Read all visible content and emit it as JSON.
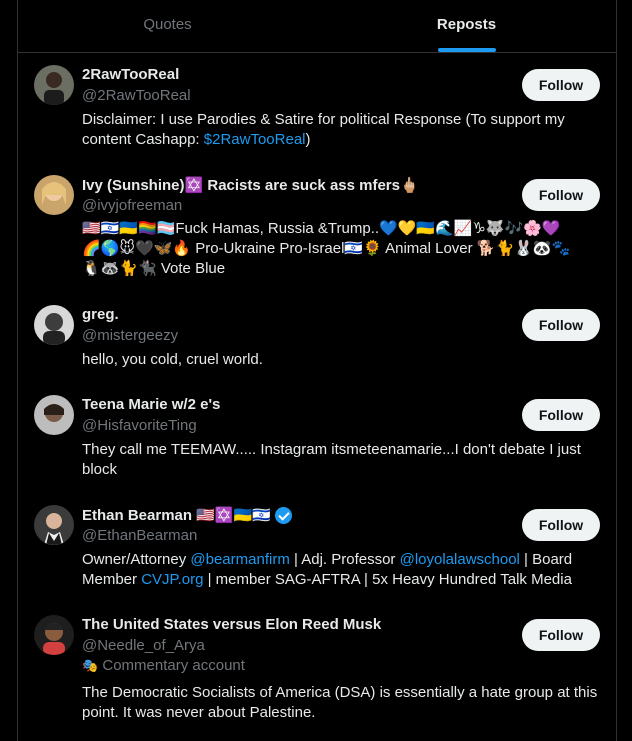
{
  "tabs": [
    {
      "label": "Quotes",
      "active": false
    },
    {
      "label": "Reposts",
      "active": true
    }
  ],
  "follow_label": "Follow",
  "users": [
    {
      "name": "2RawTooReal",
      "handle": "@2RawTooReal",
      "bio_text": "Disclaimer: I use Parodies & Satire for political Response (To support my content Cashapp: ",
      "bio_link": "$2RawTooReal",
      "bio_end": ")"
    },
    {
      "name": "Ivy (Sunshine)✡️ Racists are suck ass mfers🖕🏼",
      "handle": "@ivyjofreeman",
      "bio_line1": "🇺🇸🇮🇱🇺🇦🏳️‍🌈🏳️‍⚧️Fuck Hamas, Russia &Trump..💙💛🇺🇦🌊📈♑🐺🎶🌸💜",
      "bio_line2": "🌈🌎🐭🖤🦋🔥 Pro-Ukraine Pro-Israel🇮🇱🌻 Animal Lover 🐕🐈🐰🐼🐾",
      "bio_line3": "🐧🦝🐈🐈‍⬛ Vote Blue"
    },
    {
      "name": "greg.",
      "handle": "@mistergeezy",
      "bio": "hello, you cold, cruel world."
    },
    {
      "name": "Teena Marie w/2 e's",
      "handle": "@HisfavoriteTing",
      "bio": "They call me TEEMAW..... Instagram itsmeteenamarie...I don't debate I just block"
    },
    {
      "name": "Ethan Bearman 🇺🇸✡️🇺🇦🇮🇱",
      "handle": "@EthanBearman",
      "bio_p1": "Owner/Attorney ",
      "bio_l1": "@bearmanfirm",
      "bio_p2": " | Adj. Professor ",
      "bio_l2": "@loyolalawschool",
      "bio_p3": " | Board Member ",
      "bio_l3": "CVJP.org",
      "bio_p4": " | member SAG-AFTRA | 5x Heavy Hundred Talk Media"
    },
    {
      "name": "The United States versus Elon Reed Musk",
      "handle": "@Needle_of_Arya",
      "label": "Commentary account",
      "bio": "The Democratic Socialists of America (DSA) is essentially a hate group at this point. It was never about Palestine."
    }
  ],
  "colors": {
    "accent": "#1d9bf0",
    "background": "#000000",
    "text": "#e7e9ea",
    "muted": "#71767b"
  }
}
